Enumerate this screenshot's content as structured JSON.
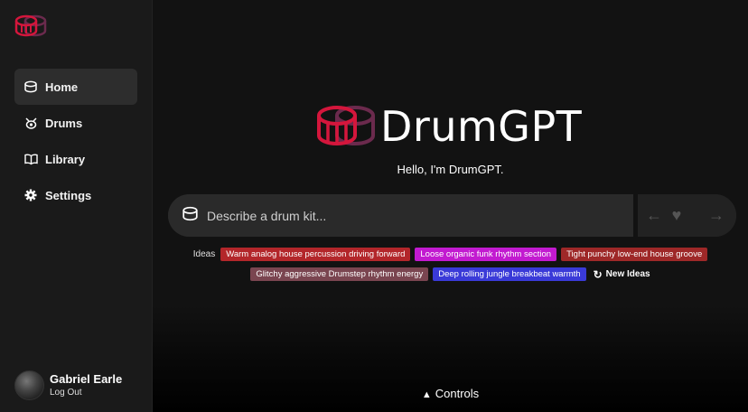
{
  "sidebar": {
    "items": [
      {
        "label": "Home",
        "icon": "drum-icon",
        "active": true
      },
      {
        "label": "Drums",
        "icon": "drum-kit-icon",
        "active": false
      },
      {
        "label": "Library",
        "icon": "book-icon",
        "active": false
      },
      {
        "label": "Settings",
        "icon": "gear-icon",
        "active": false
      }
    ],
    "user": {
      "name": "Gabriel Earle",
      "logout_label": "Log Out"
    }
  },
  "main": {
    "brand_title": "DrumGPT",
    "greeting": "Hello, I'm DrumGPT.",
    "prompt": {
      "placeholder": "Describe a drum kit..."
    },
    "ideas": {
      "label": "Ideas",
      "chips": [
        {
          "text": "Warm analog house percussion driving forward",
          "color": "#b3262a"
        },
        {
          "text": "Loose organic funk rhythm section",
          "color": "#c21ad0"
        },
        {
          "text": "Tight punchy low-end house groove",
          "color": "#9e2828"
        },
        {
          "text": "Glitchy aggressive Drumstep rhythm energy",
          "color": "#7a4550"
        },
        {
          "text": "Deep rolling jungle breakbeat warmth",
          "color": "#3a3ad8"
        }
      ],
      "new_ideas_label": "New Ideas"
    },
    "controls_label": "Controls"
  },
  "colors": {
    "brand_red": "#d4163c",
    "brand_purple": "#6b2a4d",
    "background": "#121212",
    "sidebar": "#1a1a1a"
  }
}
